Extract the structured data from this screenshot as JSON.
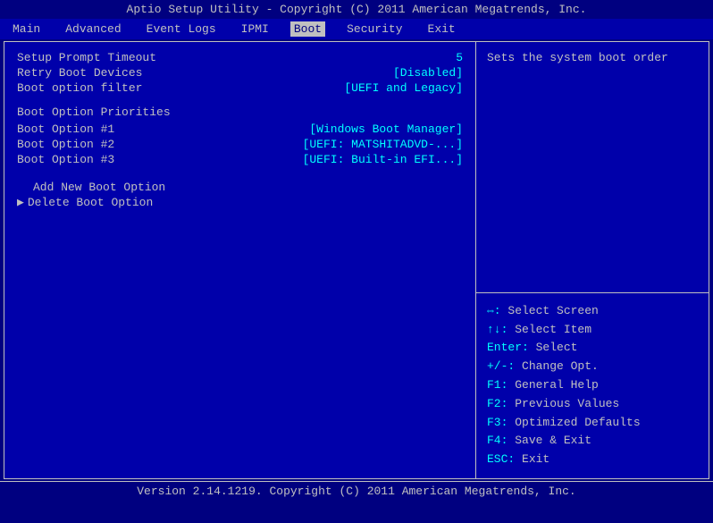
{
  "title_bar": {
    "text": "Aptio Setup Utility - Copyright (C) 2011 American Megatrends, Inc."
  },
  "menu_bar": {
    "items": [
      {
        "label": "Main",
        "active": false
      },
      {
        "label": "Advanced",
        "active": false
      },
      {
        "label": "Event Logs",
        "active": false
      },
      {
        "label": "IPMI",
        "active": false
      },
      {
        "label": "Boot",
        "active": true
      },
      {
        "label": "Security",
        "active": false
      },
      {
        "label": "Exit",
        "active": false
      }
    ]
  },
  "left_panel": {
    "rows": [
      {
        "label": "Setup Prompt Timeout",
        "value": "5"
      },
      {
        "label": "Retry Boot Devices",
        "value": "[Disabled]"
      },
      {
        "label": "Boot option filter",
        "value": "[UEFI and Legacy]"
      }
    ],
    "section_header": "Boot Option Priorities",
    "boot_options": [
      {
        "label": "Boot Option #1",
        "value": "[Windows Boot Manager]"
      },
      {
        "label": "Boot Option #2",
        "value": "[UEFI: MATSHITADVD-...]"
      },
      {
        "label": "Boot Option #3",
        "value": "[UEFI: Built-in EFI...]"
      }
    ],
    "sub_items": [
      {
        "label": "Add New Boot Option",
        "has_arrow": false
      },
      {
        "label": "Delete Boot Option",
        "has_arrow": true
      }
    ]
  },
  "right_panel": {
    "help_text": "Sets the system boot order",
    "legend": [
      {
        "key": "⇔: ",
        "desc": "Select Screen"
      },
      {
        "key": "↑↓: ",
        "desc": "Select Item"
      },
      {
        "key": "Enter: ",
        "desc": "Select"
      },
      {
        "key": "+/-: ",
        "desc": "Change Opt."
      },
      {
        "key": "F1: ",
        "desc": "General Help"
      },
      {
        "key": "F2: ",
        "desc": "Previous Values"
      },
      {
        "key": "F3: ",
        "desc": "Optimized Defaults"
      },
      {
        "key": "F4: ",
        "desc": "Save & Exit"
      },
      {
        "key": "ESC: ",
        "desc": "Exit"
      }
    ]
  },
  "footer": {
    "text": "Version 2.14.1219. Copyright (C) 2011 American Megatrends, Inc."
  }
}
